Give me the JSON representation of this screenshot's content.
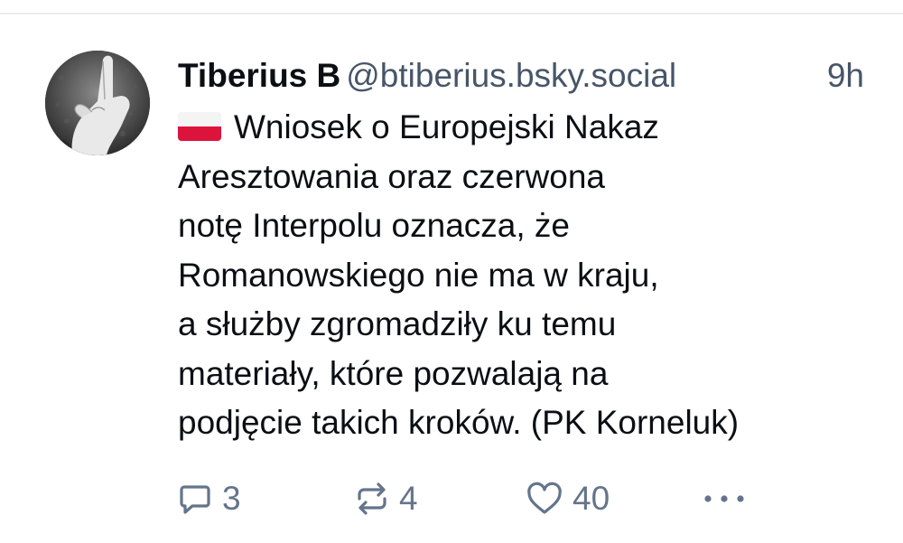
{
  "post": {
    "author": {
      "display_name": "Tiberius B",
      "handle": "@btiberius.bsky.social"
    },
    "timestamp": "9h",
    "flag_icon": "poland-flag-icon",
    "text_lines": [
      "Wniosek o Europejski Nakaz",
      "Aresztowania oraz czerwona",
      "notę Interpolu oznacza, że",
      "Romanowskiego nie ma w kraju,",
      "a służby zgromadziły ku temu",
      "materiały, które pozwalają na",
      "podjęcie takich kroków. (PK Korneluk)"
    ],
    "actions": {
      "reply_count": "3",
      "repost_count": "4",
      "like_count": "40"
    }
  },
  "colors": {
    "text": "#0b0f14",
    "muted": "#475569",
    "icon": "#64748b",
    "divider": "#e8ecf0",
    "flag_red": "#dc143c"
  }
}
